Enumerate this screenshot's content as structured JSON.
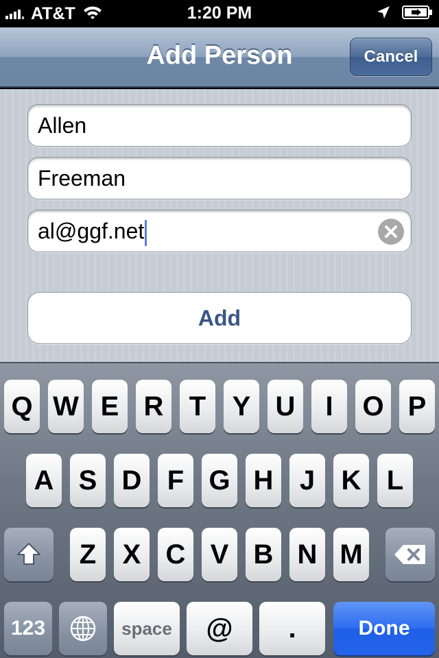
{
  "status_bar": {
    "carrier": "AT&T",
    "time": "1:20 PM",
    "icons": [
      "signal-bars-icon",
      "wifi-icon",
      "location-arrow-icon",
      "battery-charging-icon"
    ]
  },
  "nav_bar": {
    "title": "Add Person",
    "cancel_label": "Cancel"
  },
  "form": {
    "first_name": "Allen",
    "last_name": "Freeman",
    "email": "al@ggf.net",
    "add_label": "Add"
  },
  "keyboard": {
    "row1": [
      "Q",
      "W",
      "E",
      "R",
      "T",
      "Y",
      "U",
      "I",
      "O",
      "P"
    ],
    "row2": [
      "A",
      "S",
      "D",
      "F",
      "G",
      "H",
      "J",
      "K",
      "L"
    ],
    "row3": [
      "Z",
      "X",
      "C",
      "V",
      "B",
      "N",
      "M"
    ],
    "numbers_label": "123",
    "space_label": "space",
    "at_label": "@",
    "dot_label": ".",
    "done_label": "Done",
    "done_color": "#2563ea"
  }
}
